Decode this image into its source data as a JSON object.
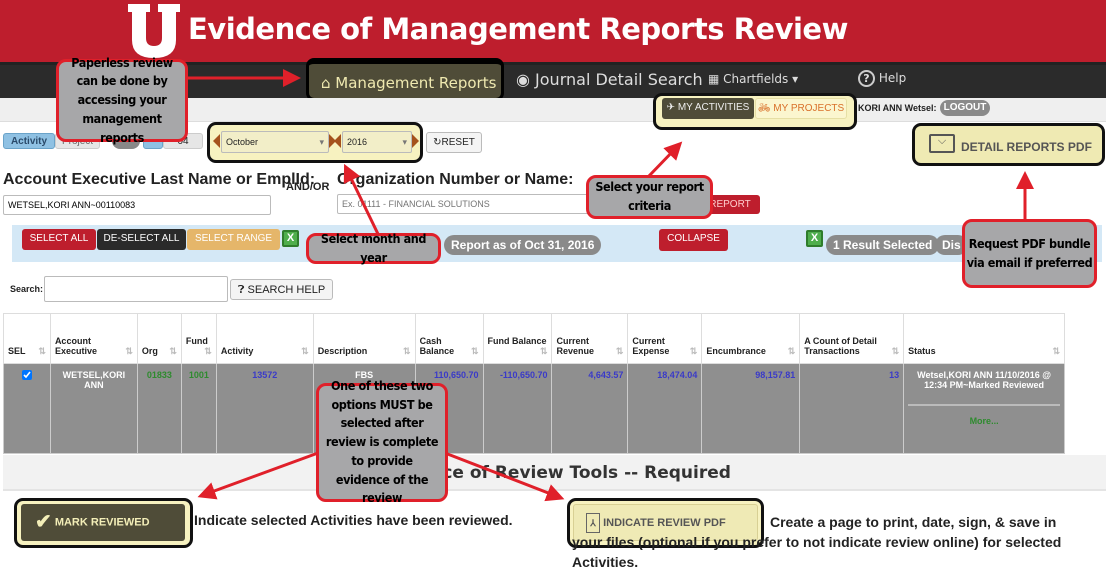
{
  "header": {
    "title": "Evidence of Management Reports Review",
    "logo": "U"
  },
  "nav": {
    "items": [
      {
        "label": "Management Reports",
        "icon": "home-icon"
      },
      {
        "label": "Journal Detail Search",
        "icon": "target-icon"
      },
      {
        "label": "Chartfields",
        "icon": "grid-icon"
      },
      {
        "label": "Help",
        "icon": "question-icon"
      }
    ]
  },
  "subbar": {
    "my_activities": "MY ACTIVITIES",
    "my_projects": "MY PROJECTS",
    "user": "KORI ANN Wetsel:",
    "logout": "LOGOUT"
  },
  "filters": {
    "toggle_activity": "Activity",
    "toggle_project": "Project",
    "small_btn": "04",
    "month": "October",
    "year": "2016",
    "reset": "RESET",
    "detail_pdf": "DETAIL REPORTS PDF",
    "ae_label": "Account Executive Last Name or EmplId:",
    "andor": "AND/OR",
    "org_label": "Organization Number or Name:",
    "ae_value": "WETSEL,KORI ANN~00110083",
    "org_placeholder": "Ex. 01111 - FINANCIAL SOLUTIONS",
    "report_btn": "REPORT"
  },
  "toolbar": {
    "select_all": "SELECT ALL",
    "deselect_all": "DE-SELECT ALL",
    "select_range": "SELECT RANGE",
    "report_as_of": "Report as of Oct 31, 2016",
    "collapse": "COLLAPSE",
    "result_selected": "1 Result Selected",
    "dis": "Dis"
  },
  "search": {
    "label": "Search:",
    "value": "",
    "help": "SEARCH HELP"
  },
  "table": {
    "headers": [
      "SEL",
      "Account Executive",
      "Org",
      "Fund",
      "Activity",
      "Description",
      "Cash Balance",
      "Fund Balance",
      "Current Revenue",
      "Current Expense",
      "Encumbrance",
      "A Count of Detail Transactions",
      "Status"
    ],
    "rows": [
      {
        "sel": true,
        "ae": "WETSEL,KORI ANN",
        "org": "01833",
        "fund": "1001",
        "activity": "13572",
        "description": "FBS",
        "cash": "110,650.70",
        "fund_bal": "-110,650.70",
        "revenue": "4,643.57",
        "expense": "18,474.04",
        "encumbrance": "98,157.81",
        "count": "13",
        "status": "Wetsel,KORI ANN 11/10/2016 @ 12:34 PM~Marked Reviewed",
        "more": "More..."
      }
    ]
  },
  "review": {
    "heading": "Evidence of Review Tools -- Required",
    "mark_reviewed": "MARK REVIEWED",
    "mark_desc": "Indicate selected Activities have been reviewed.",
    "indicate_pdf": "INDICATE REVIEW PDF",
    "pdf_desc": "Create a page to print, date, sign, & save in your files (optional if you prefer to not indicate review online) for selected Activities."
  },
  "callouts": {
    "paperless": "Paperless review can be done by accessing your management reports",
    "month_year": "Select month and year",
    "criteria": "Select your report criteria",
    "pdf_bundle": "Request PDF bundle via email if preferred",
    "options": "One of these two options MUST be selected after review is complete to provide evidence of the review"
  },
  "colors": {
    "brand_red": "#be1e2d",
    "nav_dark": "#2b2b2b",
    "highlight": "#f7f2c0",
    "callout_border": "#e0202a",
    "callout_fill": "#a7a7a9"
  }
}
